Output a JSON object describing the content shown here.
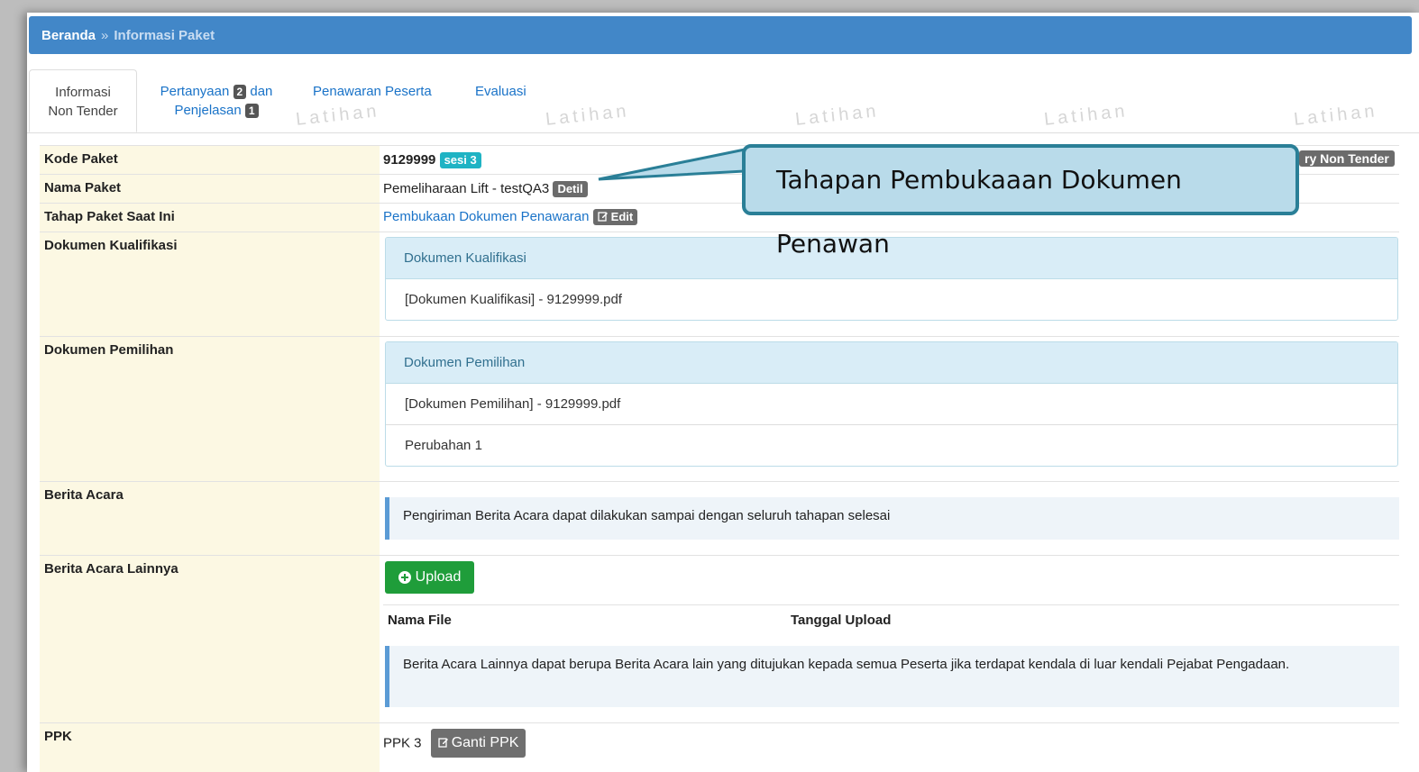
{
  "breadcrumb": {
    "home": "Beranda",
    "separator": "»",
    "current": "Informasi Paket"
  },
  "tabs": {
    "informasi_line1": "Informasi",
    "informasi_line2": "Non Tender",
    "pertanyaan_word": "Pertanyaan",
    "pertanyaan_count": "2",
    "dan": "dan",
    "penjelasan_word": "Penjelasan",
    "penjelasan_count": "1",
    "penawaran": "Penawaran Peserta",
    "evaluasi": "Evaluasi"
  },
  "watermark": "Latihan",
  "history_button": "ry Non Tender",
  "info": {
    "kode_label": "Kode Paket",
    "kode_value": "9129999",
    "sesi_badge": "sesi 3",
    "nama_label": "Nama Paket",
    "nama_value": "Pemeliharaan Lift - testQA3",
    "detil_badge": "Detil",
    "tahap_label": "Tahap Paket Saat Ini",
    "tahap_value": "Pembukaan Dokumen Penawaran",
    "edit_badge": "Edit",
    "kualifikasi_label": "Dokumen Kualifikasi",
    "kualifikasi_panel_title": "Dokumen Kualifikasi",
    "kualifikasi_file": "[Dokumen Kualifikasi] - 9129999.pdf",
    "pemilihan_label": "Dokumen Pemilihan",
    "pemilihan_panel_title": "Dokumen Pemilihan",
    "pemilihan_file": "[Dokumen Pemilihan] - 9129999.pdf",
    "pemilihan_perubahan": "Perubahan 1",
    "berita_label": "Berita Acara",
    "berita_note": "Pengiriman Berita Acara dapat dilakukan sampai dengan seluruh tahapan selesai",
    "lainnya_label": "Berita Acara Lainnya",
    "upload_button": "Upload",
    "col_nama_file": "Nama File",
    "col_tanggal": "Tanggal Upload",
    "lainnya_note": "Berita Acara Lainnya dapat berupa Berita Acara lain yang ditujukan kepada semua Peserta jika terdapat kendala di luar kendali Pejabat Pengadaan.",
    "ppk_label": "PPK",
    "ppk_value": "PPK 3",
    "ganti_button": "Ganti PPK"
  },
  "callout": {
    "text": "Tahapan Pembukaaan Dokumen Penawan"
  },
  "colors": {
    "topbar": "#4287c8",
    "label_bg": "#fcf8e3",
    "callout_border": "#2a7f97",
    "upload_green": "#1f9d3a"
  }
}
